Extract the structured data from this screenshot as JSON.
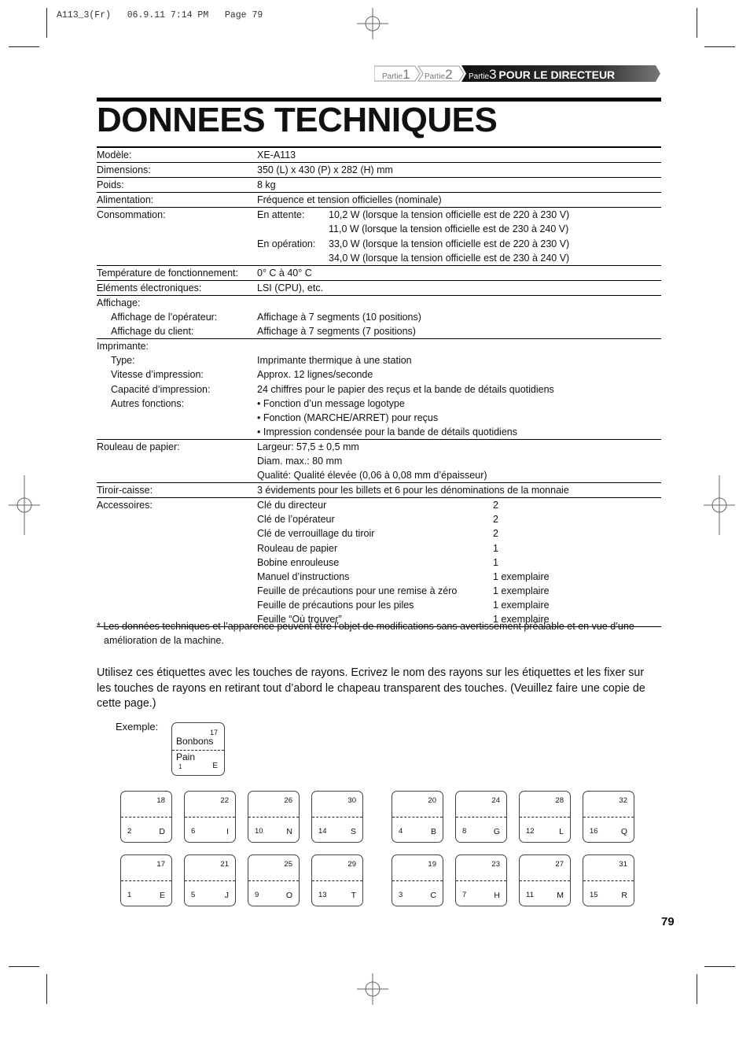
{
  "slug": "A113_3(Fr)   06.9.11 7:14 PM   Page 79",
  "breadcrumb": {
    "part1_prefix": "Partie",
    "part1_num": "1",
    "part2_prefix": "Partie",
    "part2_num": "2",
    "part3_prefix": "Partie",
    "part3_num": "3",
    "part3_label": "POUR LE DIRECTEUR"
  },
  "title": "DONNEES TECHNIQUES",
  "specs": [
    {
      "key": "Modèle:",
      "value": "XE-A113",
      "sep": true
    },
    {
      "key": "Dimensions:",
      "value": "350 (L) x 430 (P) x 282 (H) mm",
      "sep": true
    },
    {
      "key": "Poids:",
      "value": "8 kg",
      "sep": true
    },
    {
      "key": "Alimentation:",
      "value": "Fréquence et tension officielles (nominale)",
      "sep": true
    },
    {
      "key": "Consommation:",
      "value": "En attente:",
      "value2": "10,2 W (lorsque la tension officielle est de 220 à 230 V)"
    },
    {
      "key": "",
      "value": "",
      "value2": "11,0 W (lorsque la tension officielle est de 230 à 240 V)"
    },
    {
      "key": "",
      "value": "En opération:",
      "value2": "33,0 W (lorsque la tension officielle est de 220 à 230 V)"
    },
    {
      "key": "",
      "value": "",
      "value2": "34,0 W (lorsque la tension officielle est de 230 à 240 V)",
      "sep": true
    },
    {
      "key": "Température de fonctionnement:",
      "value": "0° C à 40° C",
      "sep": true
    },
    {
      "key": "Eléments électroniques:",
      "value": "LSI (CPU), etc.",
      "sep": true
    },
    {
      "key": "Affichage:",
      "value": ""
    },
    {
      "key": "Affichage de l’opérateur:",
      "value": "Affichage à 7 segments (10 positions)",
      "indent": true
    },
    {
      "key": "Affichage du client:",
      "value": "Affichage à 7 segments (7 positions)",
      "indent": true,
      "sep": true
    },
    {
      "key": "Imprimante:",
      "value": ""
    },
    {
      "key": "Type:",
      "value": "Imprimante thermique à une station",
      "indent": true
    },
    {
      "key": "Vitesse d’impression:",
      "value": "Approx. 12 lignes/seconde",
      "indent": true
    },
    {
      "key": "Capacité d’impression:",
      "value": "24 chiffres pour le papier des reçus et la bande de détails quotidiens",
      "indent": true
    },
    {
      "key": "Autres fonctions:",
      "value": "• Fonction d’un message logotype",
      "indent": true
    },
    {
      "key": "",
      "value": "• Fonction (MARCHE/ARRET) pour reçus"
    },
    {
      "key": "",
      "value": "• Impression condensée pour la bande de détails quotidiens",
      "sep": true
    },
    {
      "key": "Rouleau de papier:",
      "value": "Largeur: 57,5 ± 0,5 mm"
    },
    {
      "key": "",
      "value": "Diam. max.: 80 mm"
    },
    {
      "key": "",
      "value": "Qualité: Qualité élevée (0,06 à 0,08 mm d’épaisseur)",
      "sep": true
    },
    {
      "key": "Tiroir-caisse:",
      "value": "3 évidements pour les billets et 6 pour les dénominations de la monnaie",
      "sep": true
    },
    {
      "key": "Accessoires:",
      "value": "Clé du directeur",
      "qty": "2"
    },
    {
      "key": "",
      "value": "Clé de l’opérateur",
      "qty": "2"
    },
    {
      "key": "",
      "value": "Clé de verrouillage du tiroir",
      "qty": "2"
    },
    {
      "key": "",
      "value": "Rouleau de papier",
      "qty": "1"
    },
    {
      "key": "",
      "value": "Bobine enrouleuse",
      "qty": "1"
    },
    {
      "key": "",
      "value": "Manuel d’instructions",
      "qty": "1 exemplaire"
    },
    {
      "key": "",
      "value": "Feuille de précautions pour une remise à zéro",
      "qty": "1 exemplaire"
    },
    {
      "key": "",
      "value": "Feuille de précautions pour les piles",
      "qty": "1 exemplaire"
    },
    {
      "key": "",
      "value": "Feuille “Où trouver”",
      "qty": "1 exemplaire",
      "sep": true
    }
  ],
  "footnote_line1": "* Les données techniques et l’apparence peuvent être l’objet de modifications sans avertissement préalable et en vue d’une",
  "footnote_line2": "amélioration de la machine.",
  "intro": "Utilisez ces étiquettes avec les touches de rayons. Ecrivez le nom des rayons sur les étiquettes et les fixer sur les touches de rayons en retirant tout d’abord le chapeau transparent des touches. (Veuillez faire une copie de cette page.)",
  "example": {
    "label": "Exemple:",
    "top_num": "17",
    "top_text": "Bonbons",
    "bottom_text": "Pain",
    "bottom_num": "1",
    "letter": "E"
  },
  "key_labels": {
    "left_group": [
      [
        {
          "top": "18",
          "bottom": "2",
          "letter": "D"
        },
        {
          "top": "22",
          "bottom": "6",
          "letter": "I"
        },
        {
          "top": "26",
          "bottom": "10",
          "letter": "N"
        },
        {
          "top": "30",
          "bottom": "14",
          "letter": "S"
        }
      ],
      [
        {
          "top": "17",
          "bottom": "1",
          "letter": "E"
        },
        {
          "top": "21",
          "bottom": "5",
          "letter": "J"
        },
        {
          "top": "25",
          "bottom": "9",
          "letter": "O"
        },
        {
          "top": "29",
          "bottom": "13",
          "letter": "T"
        }
      ]
    ],
    "right_group": [
      [
        {
          "top": "20",
          "bottom": "4",
          "letter": "B"
        },
        {
          "top": "24",
          "bottom": "8",
          "letter": "G"
        },
        {
          "top": "28",
          "bottom": "12",
          "letter": "L"
        },
        {
          "top": "32",
          "bottom": "16",
          "letter": "Q"
        }
      ],
      [
        {
          "top": "19",
          "bottom": "3",
          "letter": "C"
        },
        {
          "top": "23",
          "bottom": "7",
          "letter": "H"
        },
        {
          "top": "27",
          "bottom": "11",
          "letter": "M"
        },
        {
          "top": "31",
          "bottom": "15",
          "letter": "R"
        }
      ]
    ]
  },
  "page_number": "79"
}
